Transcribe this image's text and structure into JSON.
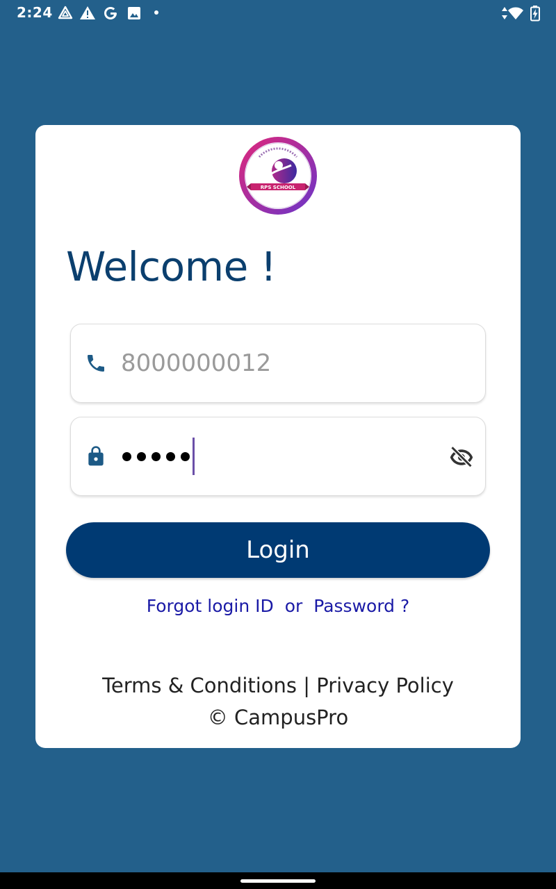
{
  "status_bar": {
    "time": "2:24",
    "left_icons": [
      "drive-icon",
      "warning-icon",
      "google-icon",
      "image-icon",
      "dot-icon"
    ],
    "right_icons": [
      "data-arrows-icon",
      "wifi-icon",
      "battery-charging-icon"
    ]
  },
  "login": {
    "welcome": "Welcome !",
    "logo_text": "RPS SCHOOL",
    "phone_value": "8000000012",
    "phone_icon": "phone-icon",
    "lock_icon": "lock-icon",
    "password_masked_length": 5,
    "visibility_icon": "eye-off-icon",
    "login_button": "Login",
    "forgot_login_id": "Forgot login ID",
    "forgot_or": "or",
    "forgot_password": "Password ?",
    "terms": "Terms & Conditions",
    "separator": "|",
    "privacy": "Privacy Policy",
    "copyright": "© CampusPro"
  },
  "colors": {
    "background": "#23608b",
    "primary": "#003a73",
    "heading": "#0b3f6e",
    "link": "#1a1aa6",
    "logo_gradient_start": "#e0287a",
    "logo_gradient_end": "#6a35c9"
  }
}
